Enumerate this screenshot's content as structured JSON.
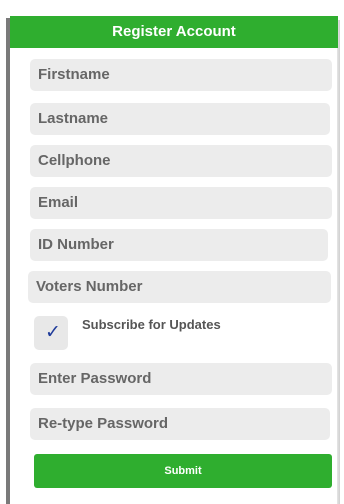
{
  "form": {
    "title": "Register Account",
    "fields": {
      "firstname": "Firstname",
      "lastname": "Lastname",
      "cellphone": "Cellphone",
      "email": "Email",
      "id_number": "ID Number",
      "voters_number": "Voters Number",
      "password": "Enter Password",
      "retype_password": "Re-type Password"
    },
    "subscribe": {
      "label": "Subscribe for Updates",
      "checked": true,
      "check_glyph": "✓"
    },
    "submit_label": "Submit"
  },
  "colors": {
    "accent": "#2fae2f",
    "field_bg": "#ececec",
    "check": "#1f3b9a"
  }
}
